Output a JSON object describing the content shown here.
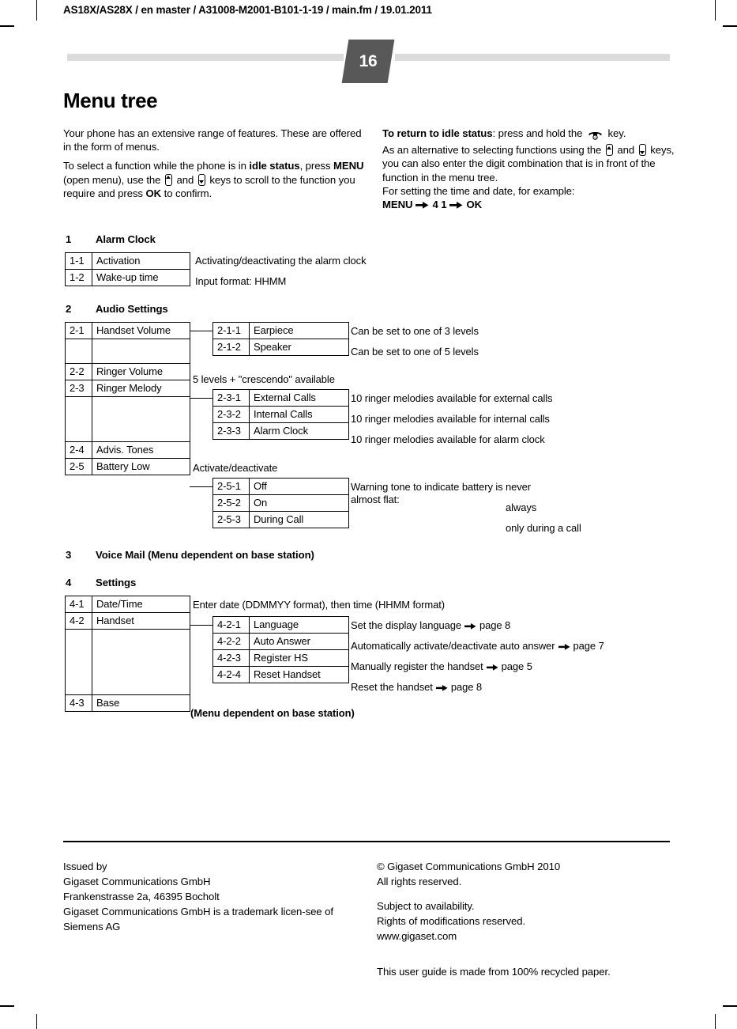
{
  "document": {
    "running_header": "AS18X/AS28X / en master / A31008-M2001-B101-1-19 / main.fm / 19.01.2011",
    "page_number": "16",
    "title": "Menu tree"
  },
  "intro": {
    "left": {
      "para1": "Your phone has an extensive range of features. These are offered in the form of menus.",
      "p2_a": "To select a function while the phone is in ",
      "p2_idle": "idle status",
      "p2_b": ", press ",
      "p2_menu": "MENU",
      "p2_c": " (open menu), use the ",
      "p2_d": " and ",
      "p2_e": " keys to scroll to the function you require and press ",
      "p2_ok": "OK",
      "p2_f": " to confirm."
    },
    "right": {
      "p1_bold": "To return to idle status",
      "p1_a": ": press and hold the ",
      "p1_b": " key.",
      "p2_a": "As an alternative to selecting functions using the ",
      "p2_b": " and ",
      "p2_c": " keys, you can also enter the digit combination that is in front of the function in the menu tree.",
      "p3": "For setting the time and date, for example:",
      "p4_menu": "MENU",
      "p4_digits": "4 1",
      "p4_ok": "OK"
    }
  },
  "sections": [
    {
      "num": "1",
      "title": "Alarm Clock"
    },
    {
      "num": "2",
      "title": "Audio Settings"
    },
    {
      "num": "3",
      "title": "Voice Mail  (Menu dependent on base station)"
    },
    {
      "num": "4",
      "title": "Settings"
    }
  ],
  "alarm_clock": {
    "rows": [
      {
        "code": "1-1",
        "label": "Activation",
        "desc": "Activating/deactivating the alarm clock"
      },
      {
        "code": "1-2",
        "label": "Wake-up time",
        "desc": "Input format: HHMM"
      }
    ]
  },
  "audio_settings": {
    "l1": [
      {
        "code": "2-1",
        "label": "Handset Volume"
      },
      {
        "code": "2-2",
        "label": "Ringer Volume"
      },
      {
        "code": "2-3",
        "label": "Ringer Melody"
      },
      {
        "code": "2-4",
        "label": "Advis. Tones"
      },
      {
        "code": "2-5",
        "label": "Battery Low"
      }
    ],
    "handset_volume_sub": [
      {
        "code": "2-1-1",
        "label": "Earpiece",
        "desc": "Can be set to one of 3 levels"
      },
      {
        "code": "2-1-2",
        "label": "Speaker",
        "desc": "Can be set to one of 5 levels"
      }
    ],
    "ringer_volume_desc": "5 levels + \"crescendo\" available",
    "ringer_melody_sub": [
      {
        "code": "2-3-1",
        "label": "External Calls",
        "desc": "10 ringer melodies available for external calls"
      },
      {
        "code": "2-3-2",
        "label": "Internal Calls",
        "desc": "10 ringer melodies available for internal calls"
      },
      {
        "code": "2-3-3",
        "label": "Alarm Clock",
        "desc": "10 ringer melodies available for alarm clock"
      }
    ],
    "advis_tones_desc": "Activate/deactivate",
    "battery_low_sub": [
      {
        "code": "2-5-1",
        "label": "Off",
        "value": "never"
      },
      {
        "code": "2-5-2",
        "label": "On",
        "value": "always"
      },
      {
        "code": "2-5-3",
        "label": "During Call",
        "value": "only during a call"
      }
    ],
    "battery_low_desc": "Warning tone to indicate battery is almost flat:"
  },
  "settings": {
    "l1": [
      {
        "code": "4-1",
        "label": "Date/Time"
      },
      {
        "code": "4-2",
        "label": "Handset"
      },
      {
        "code": "4-3",
        "label": "Base"
      }
    ],
    "date_time_desc": "Enter date (DDMMYY format), then time (HHMM format)",
    "handset_sub": [
      {
        "code": "4-2-1",
        "label": "Language",
        "desc": "Set the display language",
        "page": "page 8"
      },
      {
        "code": "4-2-2",
        "label": "Auto Answer",
        "desc": "Automatically activate/deactivate auto answer",
        "page": "page 7"
      },
      {
        "code": "4-2-3",
        "label": "Register HS",
        "desc": "Manually register the handset",
        "page": "page 5"
      },
      {
        "code": "4-2-4",
        "label": "Reset Handset",
        "desc": "Reset the handset",
        "page": "page 8"
      }
    ],
    "base_desc": "(Menu dependent on base station)"
  },
  "footer": {
    "left": {
      "line1": "Issued by",
      "line2": "Gigaset Communications GmbH",
      "line3": "Frankenstrasse 2a, 46395 Bocholt",
      "line4": "Gigaset Communications GmbH is a trademark licen-see of Siemens AG"
    },
    "right": {
      "block1_l1": "© Gigaset Communications GmbH 2010",
      "block1_l2": "All rights reserved.",
      "block2_l1": "Subject to availability.",
      "block2_l2": "Rights of modifications reserved.",
      "block2_l3": "www.gigaset.com",
      "block3": "This user guide is made from 100% recycled paper."
    }
  },
  "colors": {
    "badge_bg": "#585858",
    "band": "#dcdcdc",
    "ink": "#000000"
  }
}
